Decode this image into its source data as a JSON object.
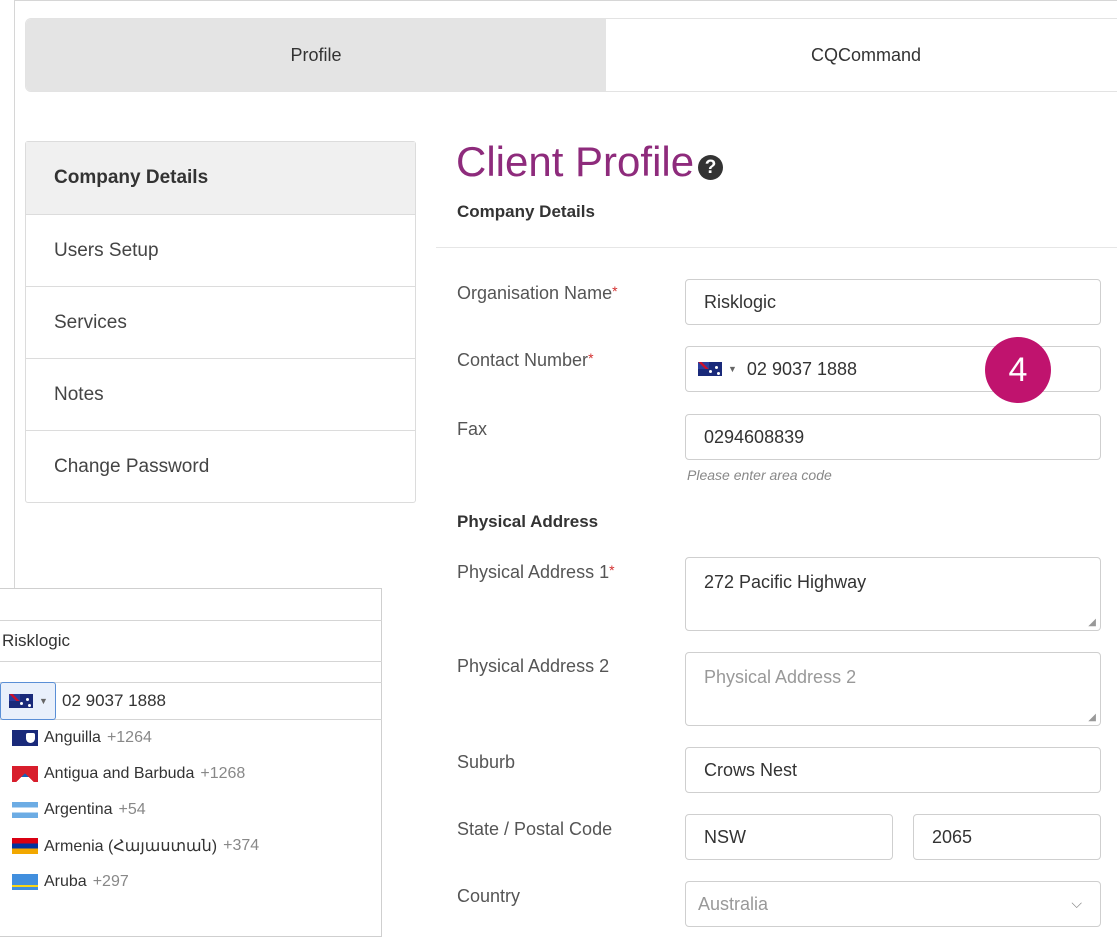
{
  "tabs": [
    {
      "label": "Profile",
      "active": true
    },
    {
      "label": "CQCommand",
      "active": false
    }
  ],
  "sidebar": {
    "items": [
      {
        "label": "Company Details",
        "active": true
      },
      {
        "label": "Users Setup",
        "active": false
      },
      {
        "label": "Services",
        "active": false
      },
      {
        "label": "Notes",
        "active": false
      },
      {
        "label": "Change Password",
        "active": false
      }
    ]
  },
  "page": {
    "title": "Client Profile",
    "help_icon_glyph": "?",
    "subtitle": "Company Details"
  },
  "form": {
    "org_name": {
      "label": "Organisation Name",
      "required_mark": "*",
      "value": "Risklogic"
    },
    "contact": {
      "label": "Contact Number",
      "required_mark": "*",
      "value": "02 9037 1888",
      "flag_icon": "australia-flag-icon"
    },
    "fax": {
      "label": "Fax",
      "value": "0294608839",
      "hint": "Please enter area code"
    },
    "physical_heading": "Physical Address",
    "address1": {
      "label": "Physical Address 1",
      "required_mark": "*",
      "value": "272 Pacific Highway"
    },
    "address2": {
      "label": "Physical Address 2",
      "placeholder": "Physical Address 2"
    },
    "suburb": {
      "label": "Suburb",
      "value": "Crows Nest"
    },
    "state_postal": {
      "label": "State / Postal Code",
      "state": "NSW",
      "postal": "2065"
    },
    "country": {
      "label": "Country",
      "value": "Australia"
    }
  },
  "step_badge": "4",
  "zoom_panel": {
    "org_value": "Risklogic",
    "phone_value": "02 9037 1888",
    "countries": [
      {
        "name": "Anguilla",
        "code": "+1264",
        "flag": "anguilla-flag-icon"
      },
      {
        "name": "Antigua and Barbuda",
        "code": "+1268",
        "flag": "antigua-flag-icon"
      },
      {
        "name": "Argentina",
        "code": "+54",
        "flag": "argentina-flag-icon"
      },
      {
        "name": "Armenia (Հայաստան)",
        "code": "+374",
        "flag": "armenia-flag-icon"
      },
      {
        "name": "Aruba",
        "code": "+297",
        "flag": "aruba-flag-icon"
      }
    ]
  },
  "colors": {
    "title": "#8e2b7c",
    "badge": "#c0136e",
    "required": "#d32f2f"
  }
}
